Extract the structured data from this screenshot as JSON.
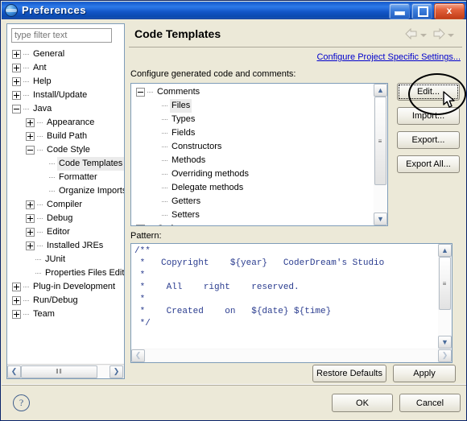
{
  "window": {
    "title": "Preferences",
    "icon": "globe-icon",
    "minimize_label": "",
    "maximize_label": "",
    "close_label": "x"
  },
  "sidebar": {
    "filter_placeholder": "type filter text",
    "filter_value": "",
    "items": [
      {
        "label": "General",
        "depth": 0,
        "toggle": "plus",
        "selected": false
      },
      {
        "label": "Ant",
        "depth": 0,
        "toggle": "plus",
        "selected": false
      },
      {
        "label": "Help",
        "depth": 0,
        "toggle": "plus",
        "selected": false
      },
      {
        "label": "Install/Update",
        "depth": 0,
        "toggle": "plus",
        "selected": false
      },
      {
        "label": "Java",
        "depth": 0,
        "toggle": "minus",
        "selected": false
      },
      {
        "label": "Appearance",
        "depth": 1,
        "toggle": "plus",
        "selected": false
      },
      {
        "label": "Build Path",
        "depth": 1,
        "toggle": "plus",
        "selected": false
      },
      {
        "label": "Code Style",
        "depth": 1,
        "toggle": "minus",
        "selected": false
      },
      {
        "label": "Code Templates",
        "depth": 2,
        "toggle": "none",
        "selected": true
      },
      {
        "label": "Formatter",
        "depth": 2,
        "toggle": "none",
        "selected": false
      },
      {
        "label": "Organize Imports",
        "depth": 2,
        "toggle": "none",
        "selected": false
      },
      {
        "label": "Compiler",
        "depth": 1,
        "toggle": "plus",
        "selected": false
      },
      {
        "label": "Debug",
        "depth": 1,
        "toggle": "plus",
        "selected": false
      },
      {
        "label": "Editor",
        "depth": 1,
        "toggle": "plus",
        "selected": false
      },
      {
        "label": "Installed JREs",
        "depth": 1,
        "toggle": "plus",
        "selected": false
      },
      {
        "label": "JUnit",
        "depth": 1,
        "toggle": "none",
        "selected": false
      },
      {
        "label": "Properties Files Edito",
        "depth": 1,
        "toggle": "none",
        "selected": false
      },
      {
        "label": "Plug-in Development",
        "depth": 0,
        "toggle": "plus",
        "selected": false
      },
      {
        "label": "Run/Debug",
        "depth": 0,
        "toggle": "plus",
        "selected": false
      },
      {
        "label": "Team",
        "depth": 0,
        "toggle": "plus",
        "selected": false
      }
    ],
    "hscroll": {
      "left_arrow": "❮",
      "right_arrow": "❯",
      "grip": "‖‖"
    }
  },
  "pane": {
    "title": "Code Templates",
    "back_tooltip": "Back",
    "forward_tooltip": "Forward",
    "project_link": "Configure Project Specific Settings...",
    "configure_label": "Configure generated code and comments:",
    "tree": [
      {
        "label": "Comments",
        "depth": 0,
        "toggle": "minus",
        "selected": false
      },
      {
        "label": "Files",
        "depth": 1,
        "toggle": "none",
        "selected": true
      },
      {
        "label": "Types",
        "depth": 1,
        "toggle": "none",
        "selected": false
      },
      {
        "label": "Fields",
        "depth": 1,
        "toggle": "none",
        "selected": false
      },
      {
        "label": "Constructors",
        "depth": 1,
        "toggle": "none",
        "selected": false
      },
      {
        "label": "Methods",
        "depth": 1,
        "toggle": "none",
        "selected": false
      },
      {
        "label": "Overriding methods",
        "depth": 1,
        "toggle": "none",
        "selected": false
      },
      {
        "label": "Delegate methods",
        "depth": 1,
        "toggle": "none",
        "selected": false
      },
      {
        "label": "Getters",
        "depth": 1,
        "toggle": "none",
        "selected": false
      },
      {
        "label": "Setters",
        "depth": 1,
        "toggle": "none",
        "selected": false
      },
      {
        "label": "Code",
        "depth": 0,
        "toggle": "plus",
        "selected": false
      }
    ],
    "buttons": {
      "edit": "Edit...",
      "import": "Import...",
      "export": "Export...",
      "export_all": "Export All..."
    },
    "pattern_label": "Pattern:",
    "pattern_text": "/**\n *   Copyright    ${year}   CoderDream's Studio\n *\n *    All    right    reserved.\n *\n *    Created    on   ${date} ${time}\n */",
    "restore_defaults": "Restore Defaults",
    "apply": "Apply"
  },
  "footer": {
    "help_icon": "?",
    "ok": "OK",
    "cancel": "Cancel"
  },
  "colors": {
    "title_bar": "#1f64d2",
    "dialog_bg": "#ece9d8",
    "link": "#0000cc",
    "pattern_text": "#2a3c8f",
    "selection_bg": "#ebebeb",
    "annotation": "#000000"
  }
}
